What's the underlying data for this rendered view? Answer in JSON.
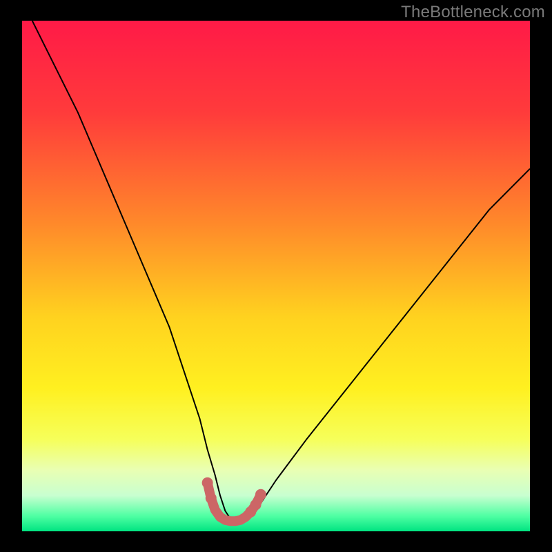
{
  "watermark": "TheBottleneck.com",
  "chart_data": {
    "type": "line",
    "title": "",
    "xlabel": "",
    "ylabel": "",
    "xlim": [
      0,
      100
    ],
    "ylim": [
      0,
      100
    ],
    "gradient_stops": [
      {
        "offset": 0.0,
        "color": "#ff1a47"
      },
      {
        "offset": 0.18,
        "color": "#ff3b3b"
      },
      {
        "offset": 0.4,
        "color": "#ff8a2a"
      },
      {
        "offset": 0.58,
        "color": "#ffd21f"
      },
      {
        "offset": 0.72,
        "color": "#fff020"
      },
      {
        "offset": 0.82,
        "color": "#f6ff5a"
      },
      {
        "offset": 0.88,
        "color": "#e9ffb3"
      },
      {
        "offset": 0.93,
        "color": "#c8ffd0"
      },
      {
        "offset": 0.97,
        "color": "#4fffa3"
      },
      {
        "offset": 1.0,
        "color": "#00e481"
      }
    ],
    "series": [
      {
        "name": "bottleneck-curve",
        "stroke": "#000000",
        "stroke_width": 2,
        "x": [
          2,
          5,
          8,
          11,
          14,
          17,
          20,
          23,
          26,
          29,
          31,
          33,
          35,
          36.5,
          38,
          39,
          40,
          41,
          42.5,
          44,
          46,
          48,
          50,
          53,
          56,
          60,
          64,
          68,
          72,
          76,
          80,
          84,
          88,
          92,
          96,
          100
        ],
        "y": [
          100,
          94,
          88,
          82,
          75,
          68,
          61,
          54,
          47,
          40,
          34,
          28,
          22,
          16,
          11,
          7,
          4,
          2.5,
          2,
          2.5,
          4,
          7,
          10,
          14,
          18,
          23,
          28,
          33,
          38,
          43,
          48,
          53,
          58,
          63,
          67,
          71
        ]
      },
      {
        "name": "optimal-zone-marker",
        "stroke": "#cc6666",
        "stroke_width": 14,
        "linecap": "round",
        "x": [
          36.5,
          37.2,
          38,
          39,
          40,
          41,
          42,
          43,
          44,
          45,
          46,
          47
        ],
        "y": [
          9.5,
          6.5,
          4.2,
          2.8,
          2.2,
          2.0,
          2.0,
          2.2,
          2.8,
          3.8,
          5.2,
          7.2
        ]
      }
    ],
    "dots": {
      "color": "#cc6666",
      "radius": 8,
      "points": [
        {
          "x": 36.5,
          "y": 9.5
        },
        {
          "x": 37.2,
          "y": 6.5
        },
        {
          "x": 45.0,
          "y": 3.8
        },
        {
          "x": 46.0,
          "y": 5.2
        },
        {
          "x": 47.0,
          "y": 7.2
        }
      ]
    }
  }
}
